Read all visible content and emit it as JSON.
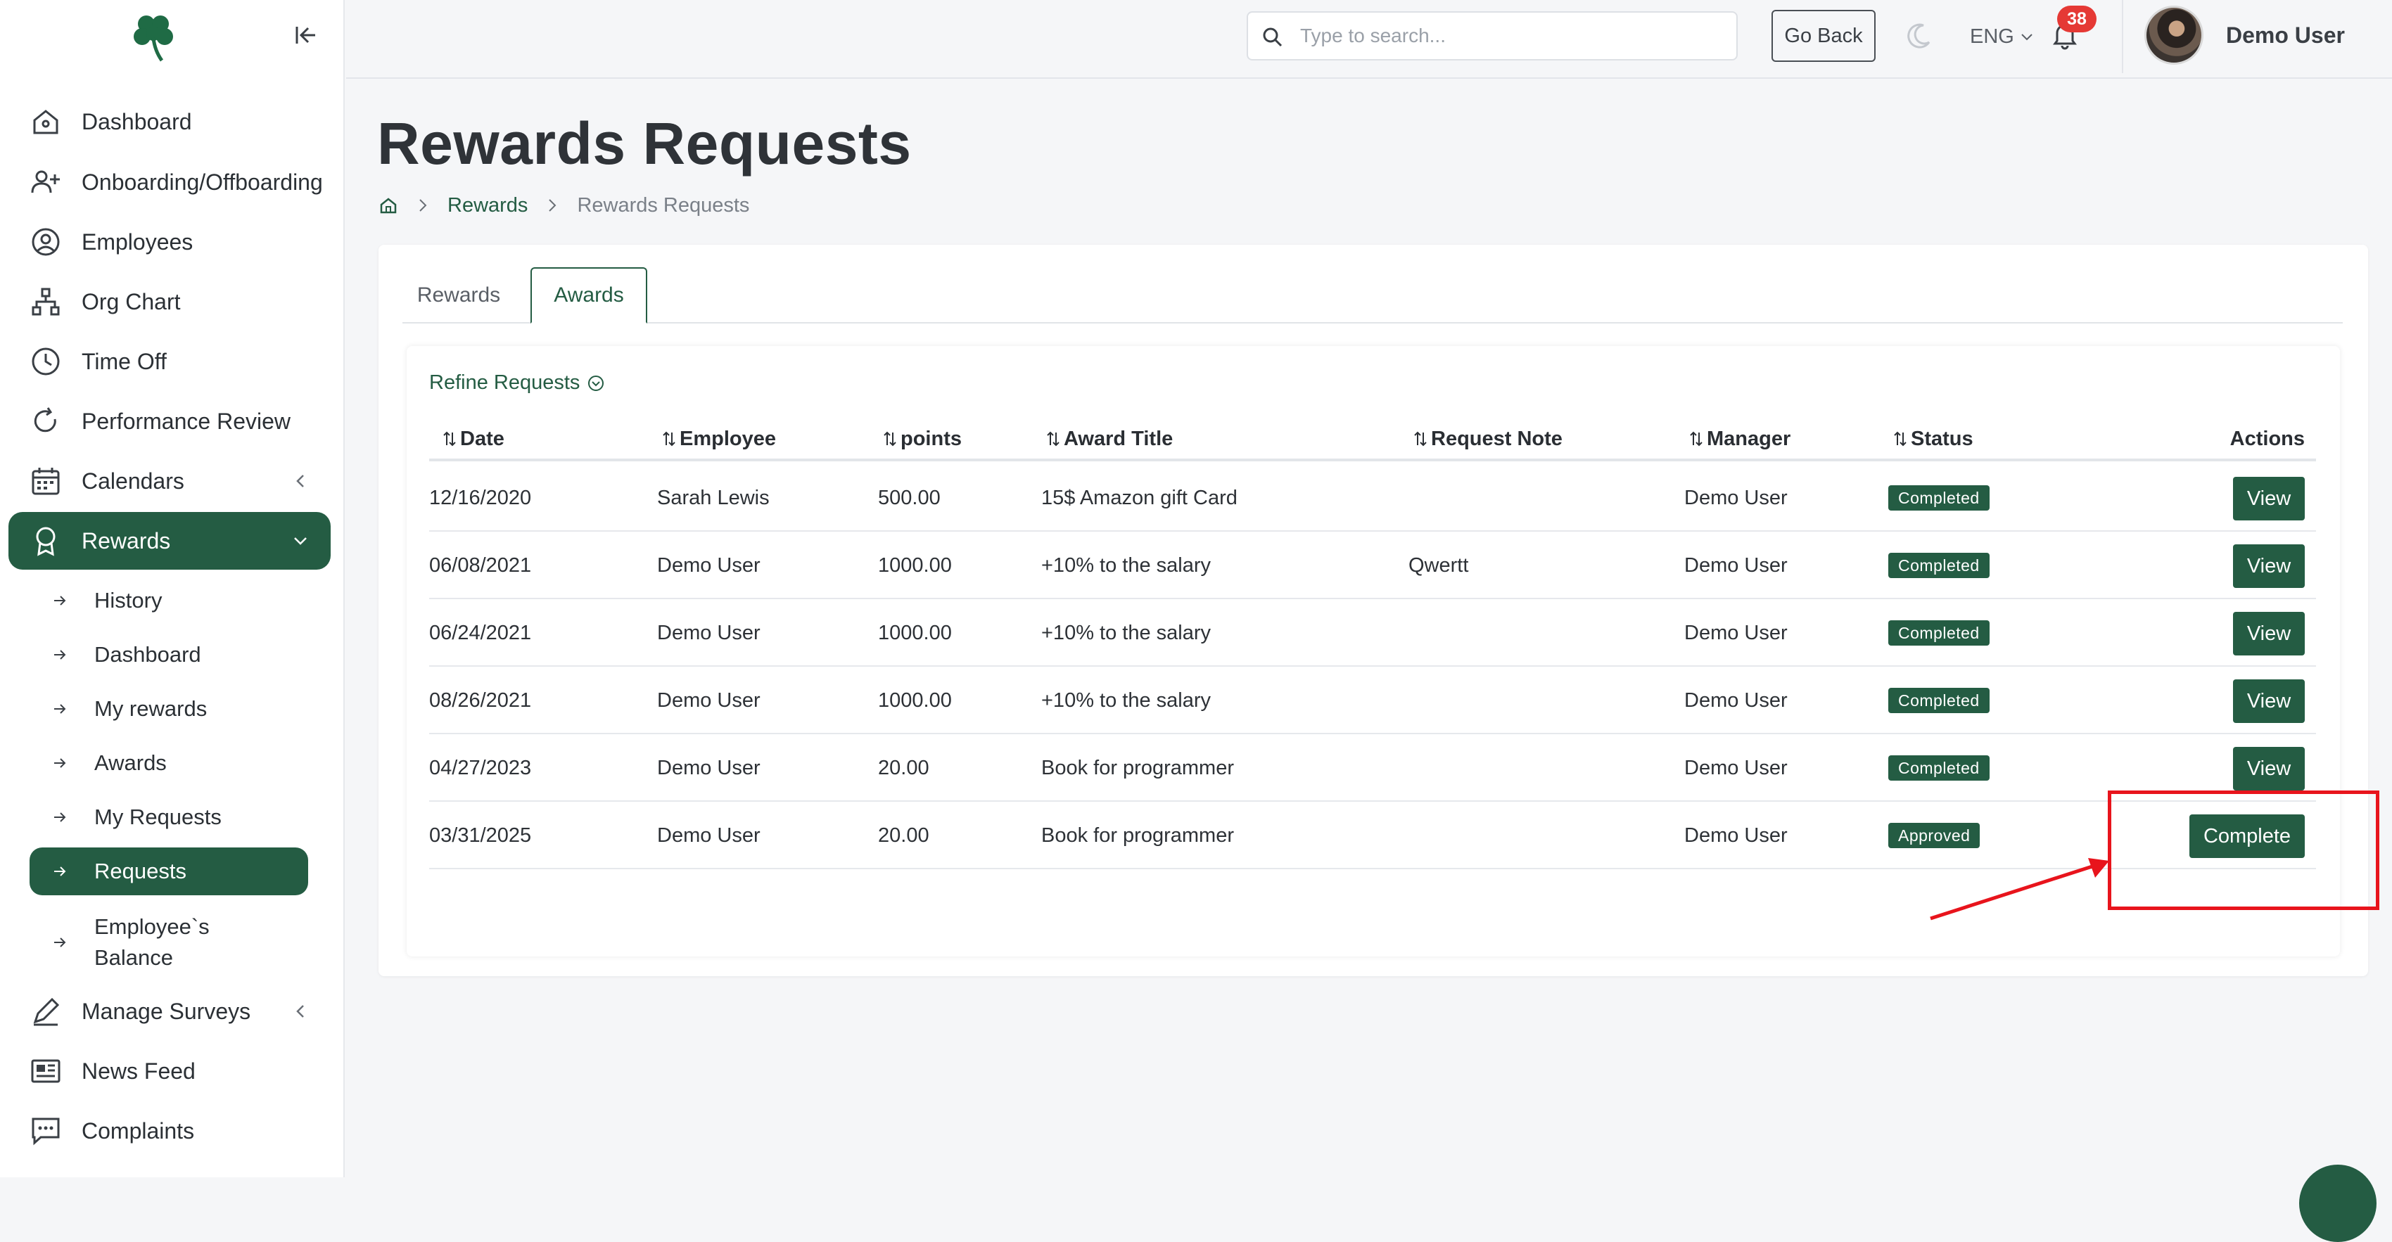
{
  "sidebar": {
    "nav": [
      {
        "label": "Dashboard",
        "icon": "home-icon"
      },
      {
        "label": "Onboarding/Offboarding",
        "icon": "user-plus-icon"
      },
      {
        "label": "Employees",
        "icon": "user-circle-icon"
      },
      {
        "label": "Org Chart",
        "icon": "org-chart-icon"
      },
      {
        "label": "Time Off",
        "icon": "clock-icon"
      },
      {
        "label": "Performance Review",
        "icon": "refresh-icon"
      },
      {
        "label": "Calendars",
        "icon": "calendar-icon"
      },
      {
        "label": "Rewards",
        "icon": "award-icon",
        "active": true
      },
      {
        "label": "Manage Surveys",
        "icon": "pen-icon"
      },
      {
        "label": "News Feed",
        "icon": "newspaper-icon"
      },
      {
        "label": "Complaints",
        "icon": "message-icon"
      }
    ],
    "rewards_sub": [
      {
        "label": "History"
      },
      {
        "label": "Dashboard"
      },
      {
        "label": "My rewards"
      },
      {
        "label": "Awards"
      },
      {
        "label": "My Requests"
      },
      {
        "label": "Requests",
        "active": true
      },
      {
        "label": "Employee`s Balance"
      }
    ]
  },
  "topbar": {
    "search_placeholder": "Type to search...",
    "go_back": "Go Back",
    "language": "ENG",
    "notifications": "38",
    "user_name": "Demo User"
  },
  "page": {
    "title": "Rewards Requests",
    "breadcrumb": [
      "Rewards",
      "Rewards Requests"
    ]
  },
  "tabs": [
    "Rewards",
    "Awards"
  ],
  "active_tab": "Awards",
  "table": {
    "refine_label": "Refine Requests",
    "columns": [
      "Date",
      "Employee",
      "points",
      "Award Title",
      "Request Note",
      "Manager",
      "Status",
      "Actions"
    ],
    "rows": [
      {
        "date": "12/16/2020",
        "employee": "Sarah Lewis",
        "points": "500.00",
        "award": "15$ Amazon gift Card",
        "note": "",
        "manager": "Demo User",
        "status": "Completed",
        "action": "View"
      },
      {
        "date": "06/08/2021",
        "employee": "Demo User",
        "points": "1000.00",
        "award": "+10% to the salary",
        "note": "Qwertt",
        "manager": "Demo User",
        "status": "Completed",
        "action": "View"
      },
      {
        "date": "06/24/2021",
        "employee": "Demo User",
        "points": "1000.00",
        "award": "+10% to the salary",
        "note": "",
        "manager": "Demo User",
        "status": "Completed",
        "action": "View"
      },
      {
        "date": "08/26/2021",
        "employee": "Demo User",
        "points": "1000.00",
        "award": "+10% to the salary",
        "note": "",
        "manager": "Demo User",
        "status": "Completed",
        "action": "View"
      },
      {
        "date": "04/27/2023",
        "employee": "Demo User",
        "points": "20.00",
        "award": "Book for programmer",
        "note": "",
        "manager": "Demo User",
        "status": "Completed",
        "action": "View"
      },
      {
        "date": "03/31/2025",
        "employee": "Demo User",
        "points": "20.00",
        "award": "Book for programmer",
        "note": "",
        "manager": "Demo User",
        "status": "Approved",
        "action": "Complete"
      }
    ]
  },
  "colors": {
    "brand": "#245c43",
    "notification": "#e53935",
    "annotation": "#e8141c"
  }
}
